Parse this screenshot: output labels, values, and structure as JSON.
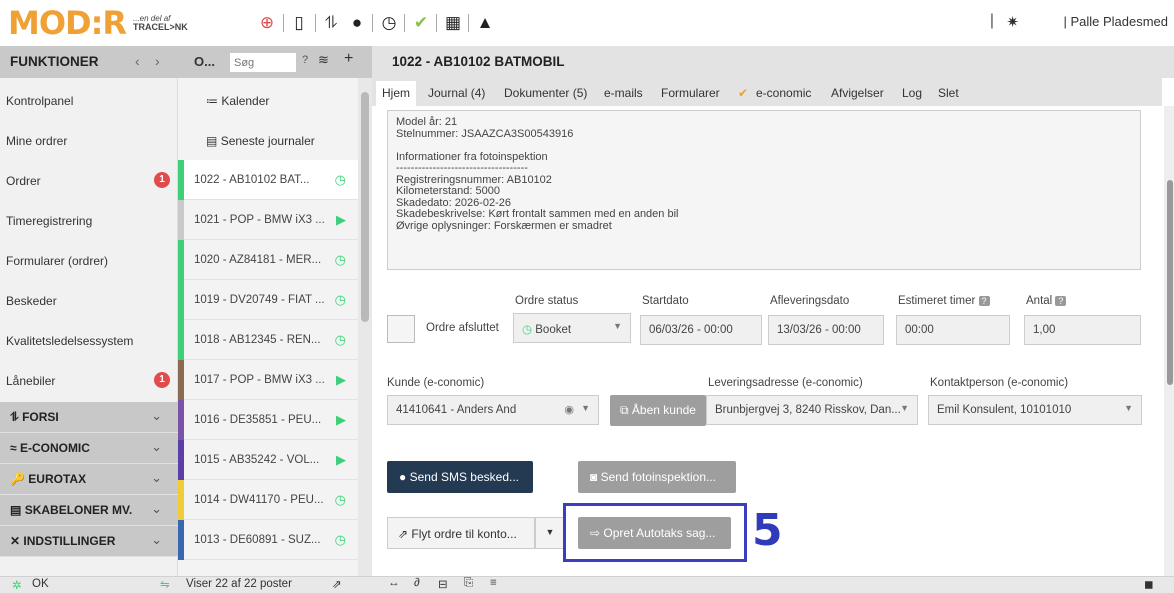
{
  "brand": {
    "logo": "MOD:R",
    "sub_small": "...en del af",
    "sub_name": "TRACEL>NK"
  },
  "user": {
    "name": "| Palle Pladesmed"
  },
  "header": {
    "left_title": "FUNKTIONER",
    "mid_title": "O...",
    "search_placeholder": "Søg",
    "order_title": "1022 - AB10102 BATMOBIL"
  },
  "sidebar": {
    "items": [
      {
        "label": "Kontrolpanel",
        "badge": ""
      },
      {
        "label": "Mine ordrer",
        "badge": ""
      },
      {
        "label": "Ordrer",
        "badge": "1"
      },
      {
        "label": "Timeregistrering",
        "badge": ""
      },
      {
        "label": "Formularer (ordrer)",
        "badge": ""
      },
      {
        "label": "Beskeder",
        "badge": ""
      },
      {
        "label": "Kvalitetsledelsessystem",
        "badge": ""
      },
      {
        "label": "Lånebiler",
        "badge": "1"
      }
    ],
    "groups": [
      {
        "icon": "⥮",
        "label": "FORSI"
      },
      {
        "icon": "≈",
        "label": "E-CONOMIC"
      },
      {
        "icon": "🔑",
        "label": "EUROTAX"
      },
      {
        "icon": "▤",
        "label": "SKABELONER MV."
      },
      {
        "icon": "✕",
        "label": "INDSTILLINGER"
      }
    ]
  },
  "orderlist": {
    "special": [
      {
        "icon": "≔",
        "label": "Kalender"
      },
      {
        "icon": "▤",
        "label": "Seneste journaler"
      }
    ],
    "rows": [
      {
        "label": "1022 - AB10102 BAT...",
        "color": "#3ecf79",
        "status": "◷",
        "status_color": "#3ecf79"
      },
      {
        "label": "1021 - POP - BMW iX3 ...",
        "color": "#c9c9c9",
        "status": "▶",
        "status_color": "#3ecf79"
      },
      {
        "label": "1020 - AZ84181 - MER...",
        "color": "#3ecf79",
        "status": "◷",
        "status_color": "#3ecf79"
      },
      {
        "label": "1019 - DV20749 - FIAT ...",
        "color": "#3ecf79",
        "status": "◷",
        "status_color": "#3ecf79"
      },
      {
        "label": "1018 - AB12345 - REN...",
        "color": "#3ecf79",
        "status": "◷",
        "status_color": "#3ecf79"
      },
      {
        "label": "1017 - POP - BMW iX3 ...",
        "color": "#8b6a52",
        "status": "▶",
        "status_color": "#3ecf79"
      },
      {
        "label": "1016 - DE35851 - PEU...",
        "color": "#7b52a8",
        "status": "▶",
        "status_color": "#3ecf79"
      },
      {
        "label": "1015 - AB35242 - VOL...",
        "color": "#5b3fa8",
        "status": "▶",
        "status_color": "#3ecf79"
      },
      {
        "label": "1014 - DW41170 - PEU...",
        "color": "#f2cc38",
        "status": "◷",
        "status_color": "#3ecf79"
      },
      {
        "label": "1013 - DE60891 - SUZ...",
        "color": "#3768b0",
        "status": "◷",
        "status_color": "#3ecf79"
      }
    ]
  },
  "tabs": [
    "Hjem",
    "Journal (4)",
    "Dokumenter (5)",
    "e-mails",
    "Formularer",
    "e-conomic",
    "Afvigelser",
    "Log",
    "Slet"
  ],
  "notes": "Model år: 21\nStelnummer: JSAAZCA3S00543916\n\nInformationer fra fotoinspektion\n------------------------------------\nRegistreringsnummer: AB10102\nKilometerstand: 5000\nSkadedato: 2026-02-26\nSkadebeskrivelse: Kørt frontalt sammen med en anden bil\nØvrige oplysninger: Forskærmen er smadret",
  "status_row": {
    "checkbox_label": "Ordre afsluttet",
    "status_label": "Ordre status",
    "status_value": "Booket",
    "start_label": "Startdato",
    "start_value": "06/03/26 - 00:00",
    "delivery_label": "Afleveringsdato",
    "delivery_value": "13/03/26 - 00:00",
    "hours_label": "Estimeret timer",
    "hours_value": "00:00",
    "qty_label": "Antal",
    "qty_value": "1,00"
  },
  "customer_row": {
    "customer_label": "Kunde (e-conomic)",
    "customer_value": "41410641 - Anders And",
    "open_customer": "Åben kunde",
    "address_label": "Leveringsadresse (e-conomic)",
    "address_value": "Brunbjergvej 3, 8240 Risskov, Dan...",
    "contact_label": "Kontaktperson (e-conomic)",
    "contact_value": "Emil Konsulent, 10101010"
  },
  "buttons": {
    "sms": "Send SMS besked...",
    "photo": "Send fotoinspektion...",
    "move": "Flyt ordre til konto...",
    "autotaks": "Opret Autotaks sag..."
  },
  "step_number": "5",
  "footer": {
    "status": "OK",
    "count": "Viser 22 af 22 poster"
  },
  "colors": {
    "accent": "#f0a136",
    "highlight": "#3c3fbd",
    "dark_button": "#233a52"
  }
}
